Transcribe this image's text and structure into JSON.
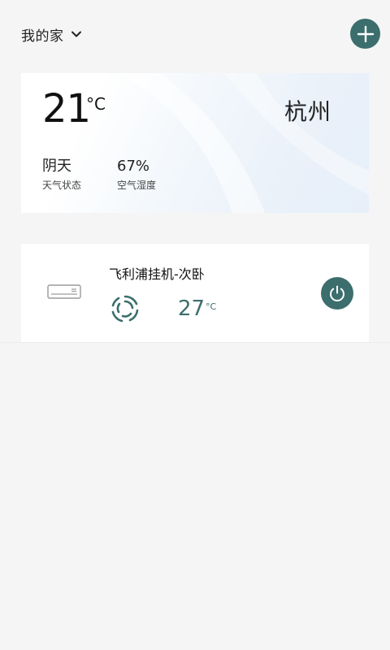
{
  "header": {
    "home_title": "我的家",
    "dropdown_icon": "chevron-down-icon",
    "add_icon": "plus-icon"
  },
  "weather": {
    "temperature": "21",
    "temperature_unit": "°C",
    "city": "杭州",
    "condition_value": "阴天",
    "condition_label": "天气状态",
    "humidity_value": "67%",
    "humidity_label": "空气湿度"
  },
  "device": {
    "name": "飞利浦挂机-次卧",
    "device_icon": "air-conditioner-icon",
    "mode_icon": "fan-icon",
    "set_temperature": "27",
    "set_temperature_unit": "°C",
    "power_icon": "power-icon"
  },
  "colors": {
    "accent": "#3b6e6c",
    "background": "#f5f5f5",
    "card": "#ffffff"
  }
}
